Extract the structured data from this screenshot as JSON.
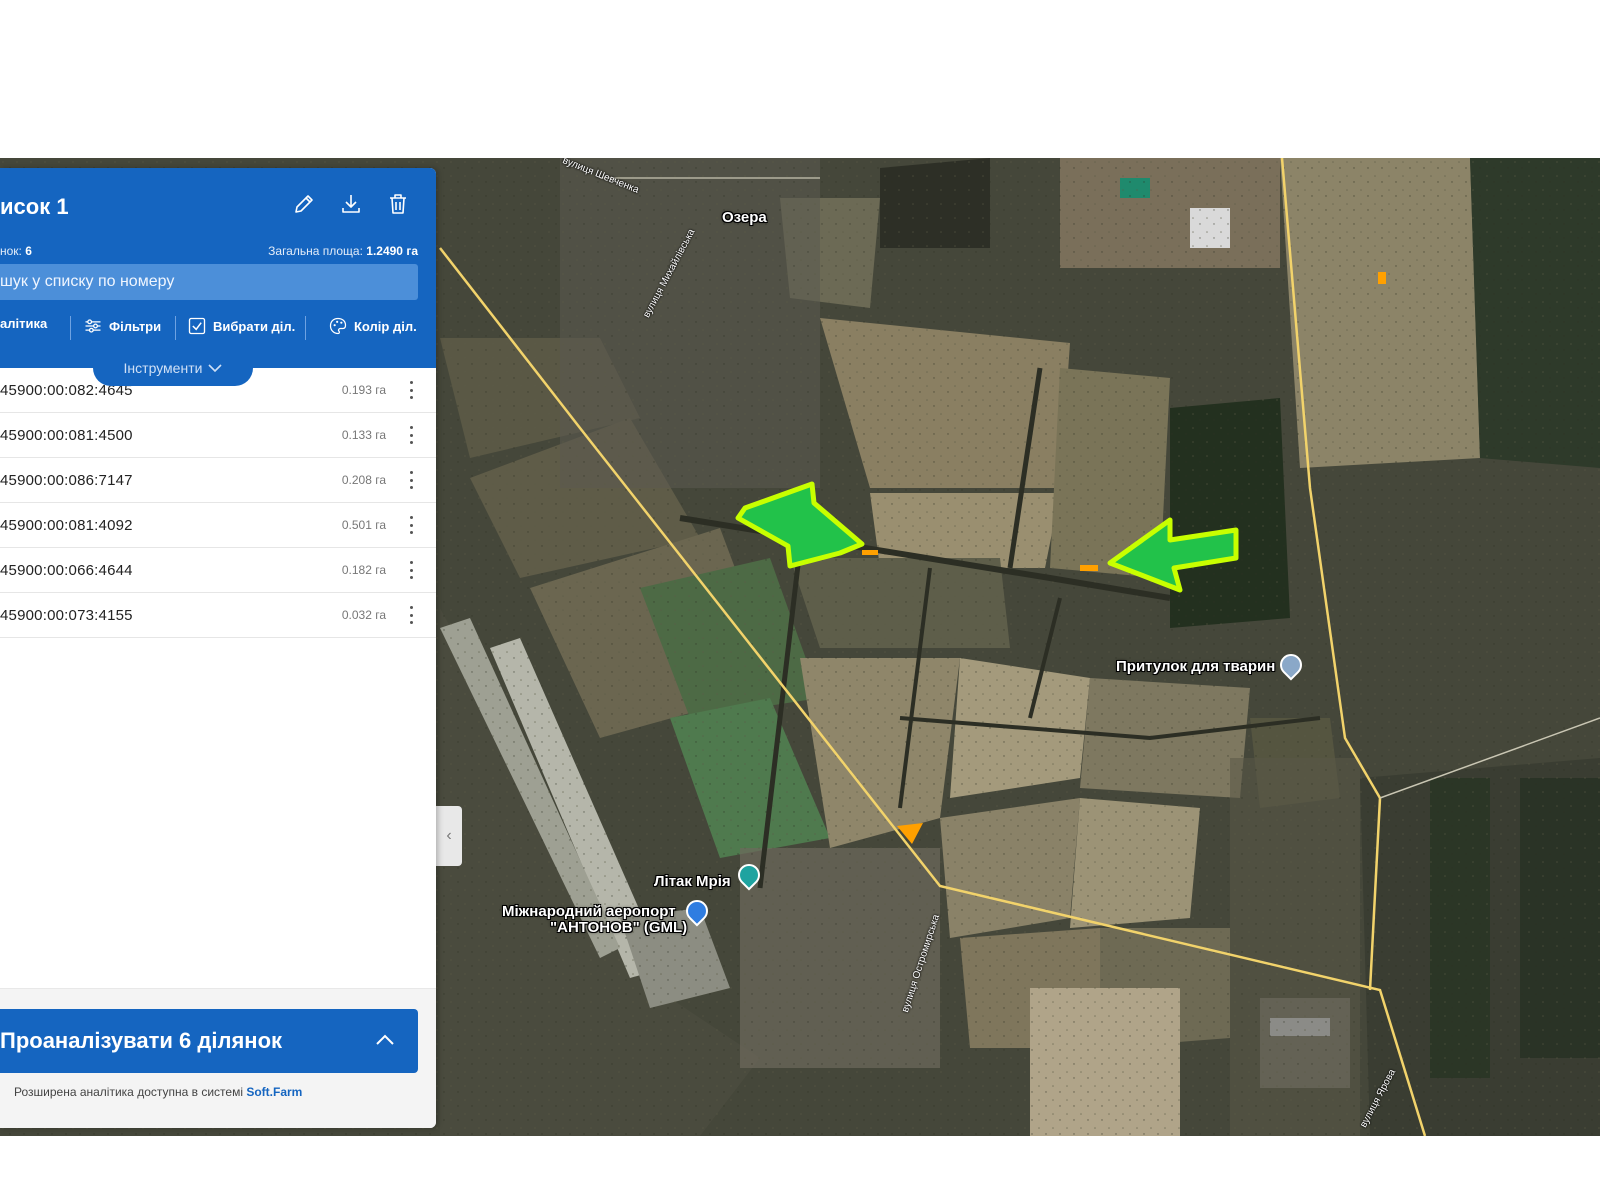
{
  "panel": {
    "title": "исок 1",
    "count_label": "нок:",
    "count_value": "6",
    "total_area_label": "Загальна площа:",
    "total_area_value": "1.2490 га",
    "search_placeholder": "шук у списку по номеру",
    "tools": {
      "analytics": "алітика",
      "filters": "Фільтри",
      "select": "Вибрати діл.",
      "color": "Колір діл."
    },
    "instruments_label": "Інструменти",
    "parcels": [
      {
        "number": "45900:00:082:4645",
        "area": "0.193 га"
      },
      {
        "number": "45900:00:081:4500",
        "area": "0.133 га"
      },
      {
        "number": "45900:00:086:7147",
        "area": "0.208 га"
      },
      {
        "number": "45900:00:081:4092",
        "area": "0.501 га"
      },
      {
        "number": "45900:00:066:4644",
        "area": "0.182 га"
      },
      {
        "number": "45900:00:073:4155",
        "area": "0.032 га"
      }
    ],
    "analyze_button": "Проаналізувати 6 ділянок",
    "footer_note": "Розширена аналітика доступна в системі",
    "footer_link": "Soft.Farm"
  },
  "map": {
    "labels": {
      "ozera": "Озера",
      "shelter": "Притулок для тварин",
      "mriya": "Літак Мрія",
      "airport_line1": "Міжнародний аеропорт",
      "airport_line2": "\"АНТОНОВ\" (GML)",
      "street_shevchenka": "вулиця Шевченка",
      "street_mykhailivska": "вулиця Михайлівська",
      "street_ostromyrska": "вулиця Остромирська",
      "street_yarova": "вулиця Ярова"
    },
    "colors": {
      "arrow_fill": "#22c24a",
      "arrow_outline": "#c8ff00",
      "parcel": "#ffa000",
      "road": "#f2d36b"
    }
  }
}
